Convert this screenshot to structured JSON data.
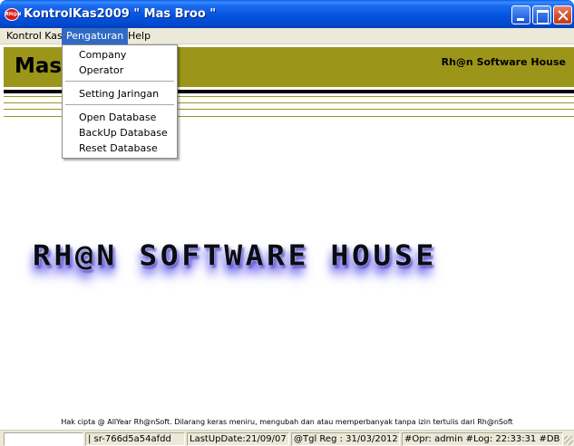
{
  "window": {
    "title": "KontrolKas2009 \" Mas Broo \"",
    "icon_text": "RH@N"
  },
  "menubar": {
    "items": [
      {
        "label": "Kontrol Kas"
      },
      {
        "label": "Pengaturan"
      },
      {
        "label": "Help"
      }
    ]
  },
  "header": {
    "title": "Mas",
    "right": "Rh@n Software House",
    "color": "#9b961a"
  },
  "dropdown": {
    "items": [
      {
        "label": "Company"
      },
      {
        "label": "Operator"
      },
      {
        "label": "Setting Jaringan"
      },
      {
        "label": "Open Database"
      },
      {
        "label": "BackUp Database"
      },
      {
        "label": "Reset Database"
      }
    ]
  },
  "splash": {
    "text": "RH@N SOFTWARE HOUSE"
  },
  "footer": {
    "copyright": "Hak cipta @ AllYear Rh@nSoft. Dilarang keras meniru, mengubah dan atau memperbanyak tanpa izin tertulis dari Rh@nSoft"
  },
  "statusbar": {
    "panels": [
      {
        "text": ""
      },
      {
        "text": "| sr-766d5a54afdd"
      },
      {
        "text": "LastUpDate:21/09/07"
      },
      {
        "text": "@Tgl Reg : 31/03/2012"
      },
      {
        "text": "#Opr: admin #Log: 22:33:31 #DB -"
      }
    ]
  }
}
